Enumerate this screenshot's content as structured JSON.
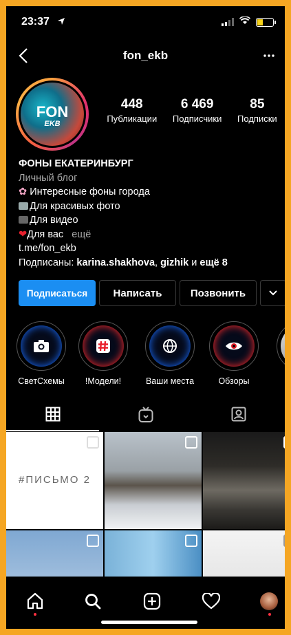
{
  "status": {
    "time": "23:37",
    "battery_level": 0.35,
    "battery_color": "#f7d31a"
  },
  "nav": {
    "back_icon": "chevron-left-icon",
    "username": "fon_ekb",
    "more_icon": "more-dots-icon"
  },
  "avatar": {
    "line1": "FON",
    "line2": "EKB"
  },
  "stats": {
    "posts": {
      "value": "448",
      "label": "Публикации"
    },
    "followers": {
      "value": "6 469",
      "label": "Подписчики"
    },
    "following": {
      "value": "85",
      "label": "Подписки"
    }
  },
  "bio": {
    "name": "ФОНЫ ЕКАТЕРИНБУРГ",
    "category": "Личный блог",
    "line1": "Интересные фоны города",
    "line2": "Для красивых фото",
    "line3": "Для видео",
    "line4": "Для вас",
    "more": "ещё",
    "link": "t.me/fon_ekb",
    "followed_prefix": "Подписаны: ",
    "followed_user1": "karina.shakhova",
    "followed_sep": ", ",
    "followed_user2": "gizhik",
    "followed_and": " и ",
    "followed_more": "ещё 8"
  },
  "buttons": {
    "follow": "Подписаться",
    "message": "Написать",
    "call": "Позвонить"
  },
  "highlights": [
    {
      "label": "СветСхемы",
      "icon": "camera-icon"
    },
    {
      "label": "!Модели!",
      "icon": "hashtag-icon"
    },
    {
      "label": "Ваши места",
      "icon": "globe-icon"
    },
    {
      "label": "Обзоры",
      "icon": "eye-icon"
    }
  ],
  "grid": {
    "post1_text": "#ПИСЬМО 2"
  },
  "colors": {
    "accent": "#1b8ef2",
    "frame": "#f5a623",
    "notification": "#ff3040"
  }
}
